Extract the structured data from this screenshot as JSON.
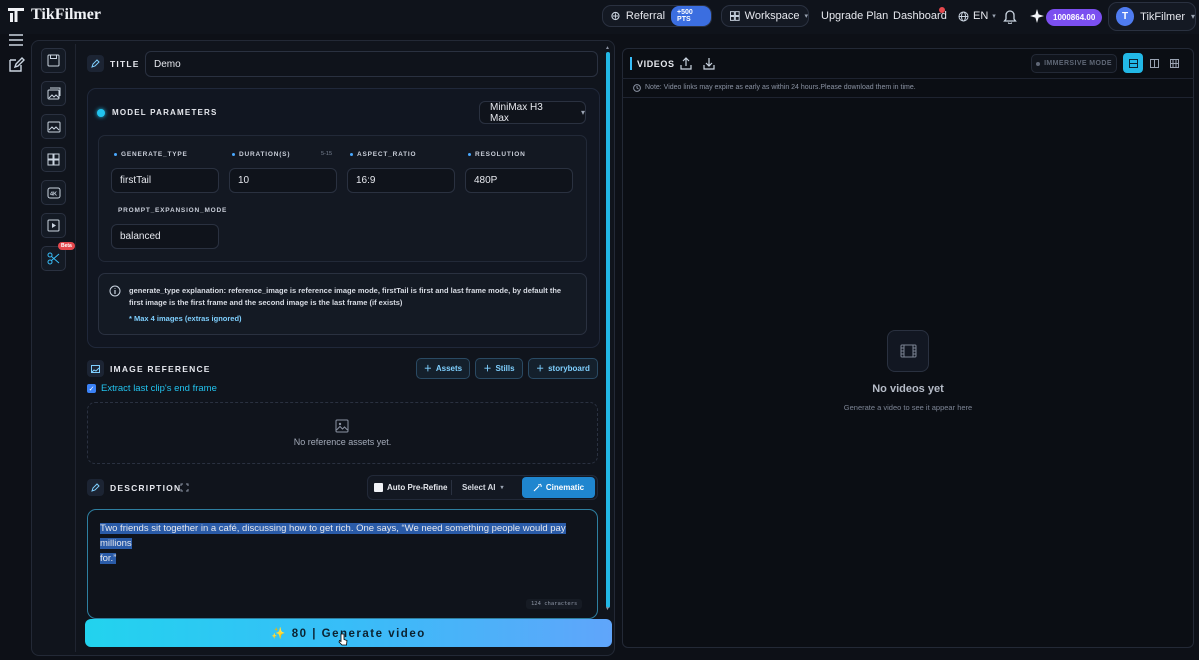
{
  "app": {
    "name": "TikFilmer"
  },
  "topbar": {
    "referral_label": "Referral",
    "referral_badge": "+500 PTS",
    "workspace_label": "Workspace",
    "upgrade_label": "Upgrade Plan",
    "dashboard_label": "Dashboard",
    "language": "EN",
    "credits": "1000864.00",
    "user_initial": "T",
    "user_name": "TikFilmer"
  },
  "editor": {
    "title_label": "TITLE",
    "title_value": "Demo",
    "model_params_label": "MODEL PARAMETERS",
    "model_selected": "MiniMax H3 Max",
    "params": {
      "generate_type_label": "GENERATE_TYPE",
      "generate_type_value": "firstTail",
      "duration_label": "DURATION(S)",
      "duration_range": "5-15",
      "duration_value": "10",
      "aspect_ratio_label": "ASPECT_RATIO",
      "aspect_ratio_value": "16:9",
      "resolution_label": "RESOLUTION",
      "resolution_value": "480P",
      "prompt_expansion_label": "PROMPT_EXPANSION_MODE",
      "prompt_expansion_value": "balanced"
    },
    "info_text_1": "generate_type explanation: reference_image is reference image mode, firstTail is first and last frame mode, by default the",
    "info_text_2": "first image is the first frame and the second image is the last frame (if exists)",
    "info_note": "* Max 4 images (extras ignored)",
    "image_ref_label": "IMAGE REFERENCE",
    "btn_assets": "Assets",
    "btn_stills": "Stills",
    "btn_storyboard": "storyboard",
    "extract_checkbox_label": "Extract last clip's end frame",
    "extract_checked": true,
    "dropzone_text": "No reference assets yet.",
    "description_label": "DESCRIPTION",
    "auto_prerefine_label": "Auto Pre-Refine",
    "select_ai_label": "Select AI",
    "cinematic_label": "Cinematic",
    "description_line_1": "Two friends sit together in a café, discussing how to get rich. One says, “We need something people would pay millions",
    "description_line_2": "for.”",
    "char_count": "124 characters",
    "generate_button": "✨ 80 | Generate video"
  },
  "videos": {
    "header": "VIDEOS",
    "immersive_label": "IMMERSIVE MODE",
    "note": "Note: Video links may expire as early as within 24 hours.Please download them in time.",
    "empty_title": "No videos yet",
    "empty_subtitle": "Generate a video to see it appear here"
  },
  "colors": {
    "accent": "#22d3ee",
    "brand_purple": "#7b4ff0",
    "background": "#0d1017"
  }
}
